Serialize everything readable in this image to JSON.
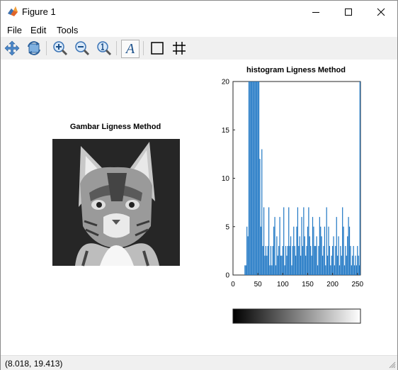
{
  "window": {
    "title": "Figure 1"
  },
  "menu": {
    "file": "File",
    "edit": "Edit",
    "tools": "Tools"
  },
  "toolbar": {
    "buttons": [
      "pan-icon",
      "rotate-icon",
      "zoom-in-icon",
      "zoom-out-icon",
      "zoom-reset-icon",
      "text-icon",
      "rectangle-icon",
      "grid-icon"
    ],
    "text_glyph": "A"
  },
  "image_panel": {
    "title": "Gambar Ligness Method",
    "image": "grayscale photo of a cat"
  },
  "colors": {
    "histogram_bar": "#1f77c4",
    "toolbar_bg": "#f0f0f0"
  },
  "chart_data": {
    "type": "bar",
    "title": "histogram Ligness Method",
    "xlabel": "",
    "ylabel": "",
    "xlim": [
      0,
      256
    ],
    "ylim": [
      0,
      20
    ],
    "xticks": [
      0,
      50,
      100,
      150,
      200,
      250
    ],
    "yticks": [
      0,
      5,
      10,
      15,
      20
    ],
    "x": [
      24,
      26,
      28,
      30,
      32,
      34,
      36,
      38,
      40,
      42,
      44,
      46,
      48,
      50,
      52,
      54,
      56,
      58,
      60,
      62,
      64,
      66,
      68,
      70,
      72,
      74,
      76,
      78,
      80,
      82,
      84,
      86,
      88,
      90,
      92,
      94,
      96,
      98,
      100,
      102,
      104,
      106,
      108,
      110,
      112,
      114,
      116,
      118,
      120,
      122,
      124,
      126,
      128,
      130,
      132,
      134,
      136,
      138,
      140,
      142,
      144,
      146,
      148,
      150,
      152,
      154,
      156,
      158,
      160,
      162,
      164,
      166,
      168,
      170,
      172,
      174,
      176,
      178,
      180,
      182,
      184,
      186,
      188,
      190,
      192,
      194,
      196,
      198,
      200,
      202,
      204,
      206,
      208,
      210,
      212,
      214,
      216,
      218,
      220,
      222,
      224,
      226,
      228,
      230,
      232,
      234,
      236,
      238,
      240,
      242,
      244,
      246,
      248,
      250,
      252,
      254,
      255
    ],
    "values": [
      1,
      1,
      5,
      4,
      20,
      20,
      20,
      20,
      20,
      20,
      20,
      20,
      20,
      20,
      20,
      12,
      5,
      13,
      3,
      7,
      2,
      3,
      2,
      3,
      7,
      1,
      3,
      1,
      3,
      5,
      6,
      1,
      4,
      2,
      3,
      6,
      2,
      2,
      3,
      7,
      1,
      3,
      2,
      3,
      7,
      3,
      4,
      1,
      3,
      5,
      3,
      2,
      5,
      7,
      3,
      4,
      2,
      6,
      3,
      7,
      4,
      2,
      3,
      5,
      7,
      4,
      3,
      2,
      6,
      5,
      3,
      3,
      4,
      1,
      3,
      6,
      5,
      4,
      2,
      3,
      5,
      1,
      7,
      2,
      5,
      3,
      1,
      2,
      3,
      4,
      1,
      3,
      6,
      2,
      4,
      1,
      3,
      2,
      7,
      5,
      1,
      3,
      2,
      4,
      6,
      5,
      3,
      1,
      2,
      3,
      1,
      2,
      1,
      3,
      2,
      1,
      20
    ]
  },
  "colorbar": {
    "colormap": "gray",
    "range": [
      0,
      255
    ]
  },
  "status": {
    "coords": "(8.018, 19.413)"
  }
}
